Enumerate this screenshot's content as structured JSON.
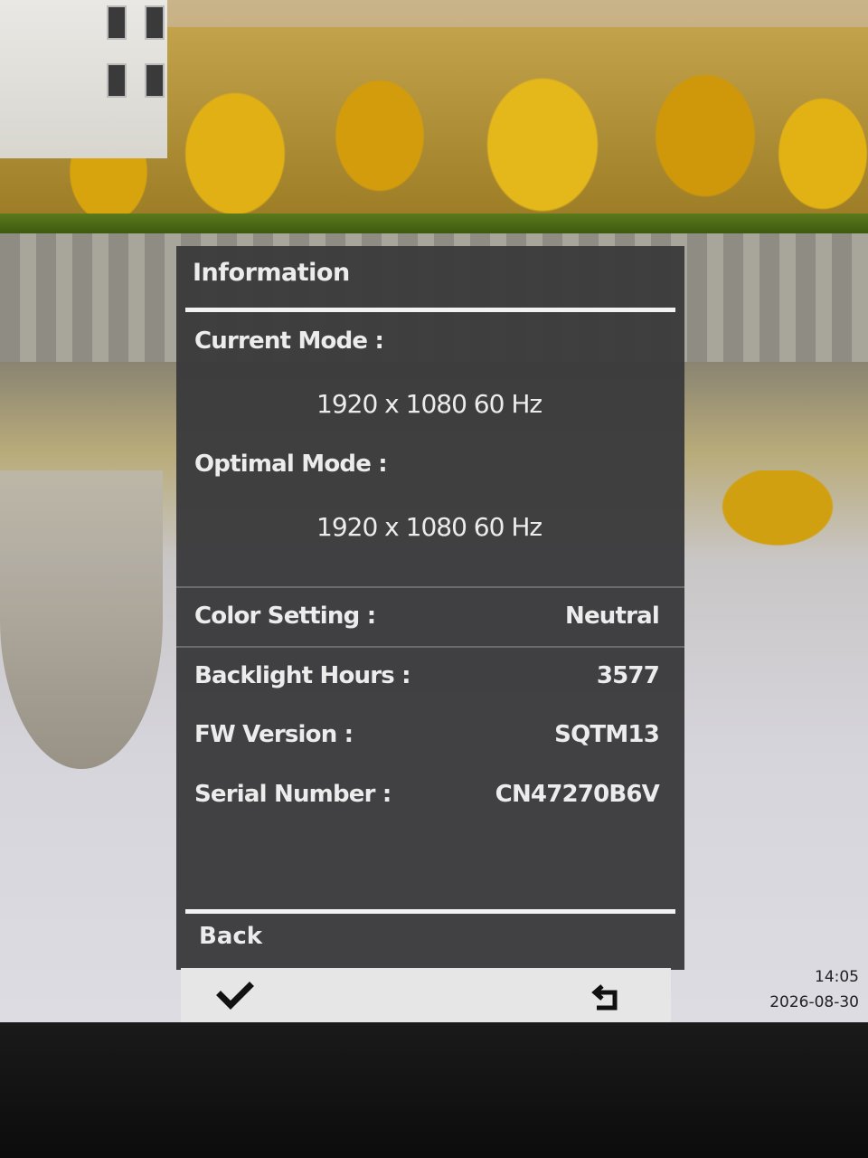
{
  "osd": {
    "title": "Information",
    "current_mode_label": "Current Mode :",
    "current_mode_value": "1920 x 1080   60 Hz",
    "optimal_mode_label": "Optimal Mode :",
    "optimal_mode_value": "1920 x 1080   60 Hz",
    "rows": [
      {
        "label": "Color Setting :",
        "value": "Neutral"
      },
      {
        "label": "Backlight Hours :",
        "value": "3577"
      },
      {
        "label": "FW Version :",
        "value": "SQTM13"
      },
      {
        "label": "Serial Number :",
        "value": "CN47270B6V"
      }
    ],
    "back_label": "Back"
  },
  "buttons": [
    {
      "icon": "checkmark-icon"
    },
    {
      "icon": "return-arrow-icon"
    }
  ],
  "taskbar": {
    "time": "14:05",
    "date": "2026-08-30"
  },
  "colors": {
    "osd_background": "#3a3a3c",
    "osd_text": "#ececec",
    "button_bar": "#e6e6e6"
  }
}
